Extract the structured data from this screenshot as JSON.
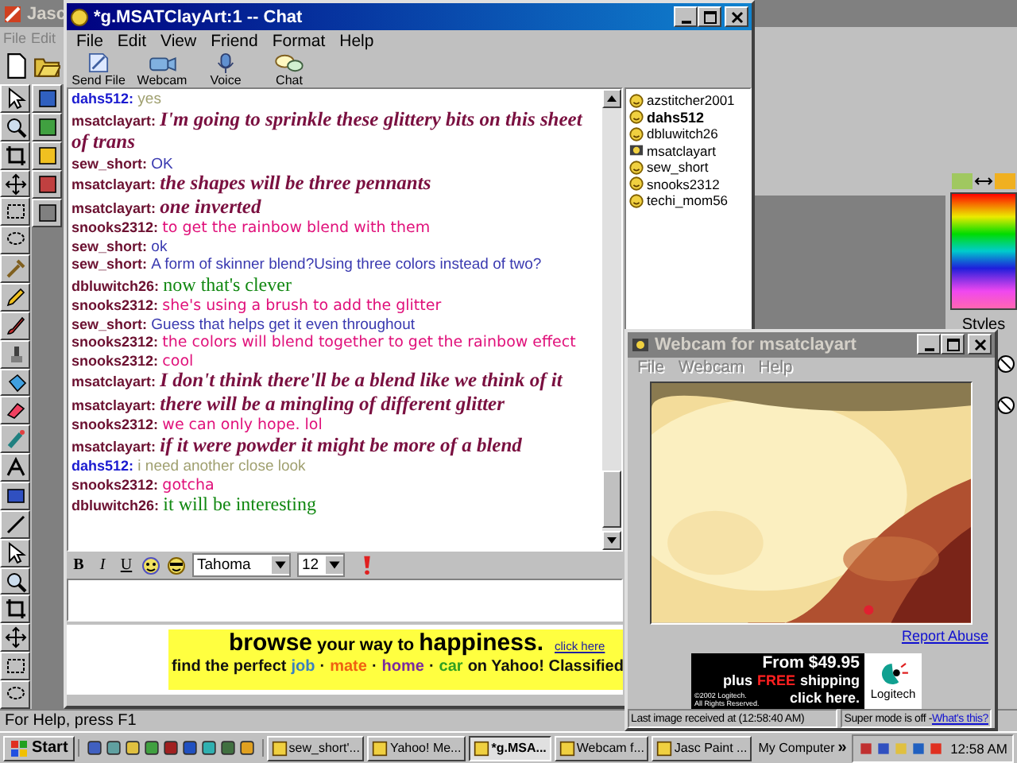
{
  "paint_app": {
    "title": "Jasc",
    "active": false,
    "menu": [
      {
        "label": "File",
        "disabled": true
      },
      {
        "label": "Edit",
        "disabled": true
      }
    ],
    "styles_label": "Styles",
    "status": "For Help, press F1"
  },
  "chat_window": {
    "title": "*g.MSATClayArt:1 -- Chat",
    "active": true,
    "menu": [
      "File",
      "Edit",
      "View",
      "Friend",
      "Format",
      "Help"
    ],
    "toolbar": [
      {
        "label": "Send File",
        "kind": "file"
      },
      {
        "label": "Webcam",
        "kind": "webcam"
      },
      {
        "label": "Voice",
        "kind": "voice"
      },
      {
        "label": "Chat",
        "kind": "chat"
      }
    ],
    "messages": [
      {
        "user": {
          "name": "dahs512:",
          "color": "#1a1ad0"
        },
        "text": "yes",
        "kind": "plain",
        "color": "#a0a070"
      },
      {
        "user": {
          "name": "msatclayart:",
          "color": "#6b1030"
        },
        "text": "I'm going to sprinkle these glittery bits on this sheet of trans",
        "kind": "script",
        "color": "#7a1040"
      },
      {
        "user": {
          "name": "sew_short:",
          "color": "#6b1030"
        },
        "text": "OK",
        "kind": "plain",
        "color": "#3a3ab0"
      },
      {
        "user": {
          "name": "msatclayart:",
          "color": "#6b1030"
        },
        "text": "the shapes will be three pennants",
        "kind": "script",
        "color": "#7a1040"
      },
      {
        "user": {
          "name": "msatclayart:",
          "color": "#6b1030"
        },
        "text": "one inverted",
        "kind": "script",
        "color": "#7a1040"
      },
      {
        "user": {
          "name": "snooks2312:",
          "color": "#6b1030"
        },
        "text": "to get the rainbow blend with them",
        "kind": "rounded",
        "color": "#e0107a"
      },
      {
        "user": {
          "name": "sew_short:",
          "color": "#6b1030"
        },
        "text": "ok",
        "kind": "plain",
        "color": "#3a3ab0"
      },
      {
        "user": {
          "name": "sew_short:",
          "color": "#6b1030"
        },
        "text": "A form of skinner blend?Using three colors instead of two?",
        "kind": "plain",
        "color": "#3a3ab0"
      },
      {
        "user": {
          "name": "dbluwitch26:",
          "color": "#6b1030"
        },
        "text": "now that's clever",
        "kind": "serif",
        "color": "#118811"
      },
      {
        "user": {
          "name": "snooks2312:",
          "color": "#6b1030"
        },
        "text": "she's using a brush to add the glitter",
        "kind": "rounded",
        "color": "#e0107a"
      },
      {
        "user": {
          "name": "sew_short:",
          "color": "#6b1030"
        },
        "text": "Guess that helps get it even throughout",
        "kind": "plain",
        "color": "#3a3ab0"
      },
      {
        "user": {
          "name": "snooks2312:",
          "color": "#6b1030"
        },
        "text": "the colors will blend together to get the rainbow effect",
        "kind": "rounded",
        "color": "#e0107a"
      },
      {
        "user": {
          "name": "snooks2312:",
          "color": "#6b1030"
        },
        "text": "cool",
        "kind": "rounded",
        "color": "#e0107a"
      },
      {
        "user": {
          "name": "msatclayart:",
          "color": "#6b1030"
        },
        "text": "I don't think there'll be a blend like we think of it",
        "kind": "script",
        "color": "#7a1040"
      },
      {
        "user": {
          "name": "msatclayart:",
          "color": "#6b1030"
        },
        "text": "there will be a mingling of different glitter",
        "kind": "script",
        "color": "#7a1040"
      },
      {
        "user": {
          "name": "snooks2312:",
          "color": "#6b1030"
        },
        "text": "we can only hope. lol",
        "kind": "rounded",
        "color": "#e0107a"
      },
      {
        "user": {
          "name": "msatclayart:",
          "color": "#6b1030"
        },
        "text": "if it were powder it might be more of a blend",
        "kind": "script",
        "color": "#7a1040"
      },
      {
        "user": {
          "name": "dahs512:",
          "color": "#1a1ad0"
        },
        "text": "i need another close look",
        "kind": "plain",
        "color": "#a0a070"
      },
      {
        "user": {
          "name": "snooks2312:",
          "color": "#6b1030"
        },
        "text": "gotcha",
        "kind": "rounded",
        "color": "#e0107a"
      },
      {
        "user": {
          "name": "dbluwitch26:",
          "color": "#6b1030"
        },
        "text": "it will be interesting",
        "kind": "serif",
        "color": "#118811"
      }
    ],
    "users": [
      {
        "name": "azstitcher2001",
        "highlighted": false,
        "kind": "smiley"
      },
      {
        "name": "dahs512",
        "highlighted": true,
        "kind": "smiley"
      },
      {
        "name": "dbluwitch26",
        "highlighted": false,
        "kind": "smiley"
      },
      {
        "name": "msatclayart",
        "highlighted": false,
        "kind": "webcam"
      },
      {
        "name": "sew_short",
        "highlighted": false,
        "kind": "smiley"
      },
      {
        "name": "snooks2312",
        "highlighted": false,
        "kind": "smiley"
      },
      {
        "name": "techi_mom56",
        "highlighted": false,
        "kind": "smiley"
      }
    ],
    "format_bar": {
      "style_buttons": [
        {
          "label": "B",
          "kind": "bold"
        },
        {
          "label": "I",
          "kind": "italic"
        },
        {
          "label": "U",
          "kind": "underline"
        }
      ],
      "font": "Tahoma",
      "size": "12"
    },
    "ad": {
      "headline": [
        {
          "text": "browse",
          "kind": "big"
        },
        {
          "text": "your way to",
          "kind": "small"
        },
        {
          "text": "happiness.",
          "kind": "big"
        }
      ],
      "link": "click here",
      "line": [
        {
          "text": "find the perfect",
          "color": "#111111"
        },
        {
          "text": "job",
          "color": "#3a80c0"
        },
        {
          "text": "·",
          "color": "#111111"
        },
        {
          "text": "mate",
          "color": "#f06010"
        },
        {
          "text": "·",
          "color": "#111111"
        },
        {
          "text": "home",
          "color": "#7a2aa0"
        },
        {
          "text": "·",
          "color": "#111111"
        },
        {
          "text": "car",
          "color": "#30a020"
        },
        {
          "text": "on Yahoo! Classified",
          "color": "#111111"
        }
      ]
    }
  },
  "webcam_window": {
    "title": "Webcam for msatclayart",
    "active": false,
    "menu": [
      {
        "label": "File",
        "disabled": true
      },
      {
        "label": "Webcam",
        "disabled": true
      },
      {
        "label": "Help",
        "disabled": true
      }
    ],
    "report_link": "Report Abuse",
    "ad": {
      "price": "From $49.95",
      "shipping": [
        {
          "text": "plus",
          "highlight": false
        },
        {
          "text": "FREE",
          "highlight": true
        },
        {
          "text": "shipping",
          "highlight": false
        }
      ],
      "cta": "click here.",
      "copyright": [
        "©2002 Logitech.",
        "All Rights Reserved."
      ],
      "brand": "Logitech"
    },
    "status": "Last image received at (12:58:40 AM)",
    "mode": "Super mode is off - ",
    "mode_link": "What's this?"
  },
  "taskbar": {
    "start": "Start",
    "tasks": [
      {
        "label": "sew_short'...",
        "selected": false
      },
      {
        "label": "Yahoo! Me...",
        "selected": false
      },
      {
        "label": "*g.MSA...",
        "selected": true
      },
      {
        "label": "Webcam f...",
        "selected": false
      },
      {
        "label": "Jasc Paint ...",
        "selected": false
      }
    ],
    "address": "My Computer",
    "more": "»",
    "clock": "12:58 AM"
  }
}
